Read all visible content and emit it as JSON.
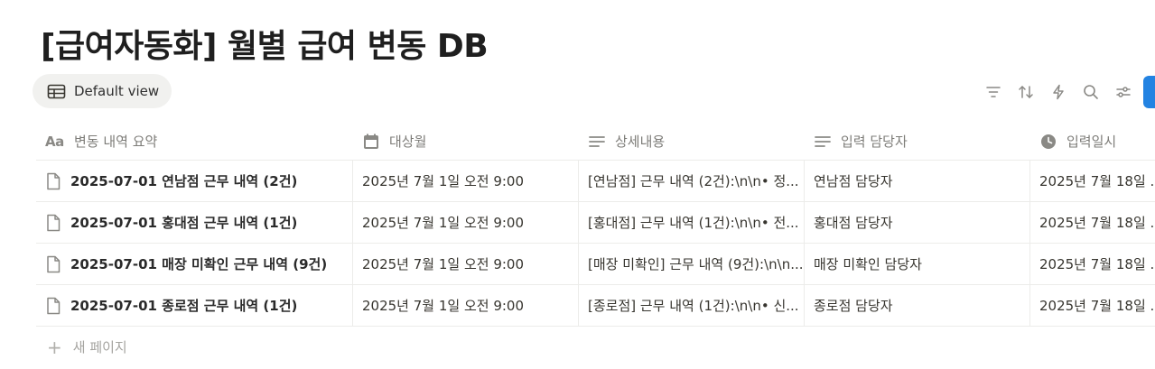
{
  "page": {
    "title": "[급여자동화] 월별 급여 변동 DB"
  },
  "views": {
    "active_label": "Default view"
  },
  "toolbar": {
    "icons": [
      "filter-icon",
      "sort-icon",
      "automation-icon",
      "search-icon",
      "settings-icon"
    ]
  },
  "table": {
    "columns": [
      {
        "label": "변동 내역 요약",
        "icon": "title-aa-icon"
      },
      {
        "label": "대상월",
        "icon": "calendar-icon"
      },
      {
        "label": "상세내용",
        "icon": "text-lines-icon"
      },
      {
        "label": "입력 담당자",
        "icon": "text-lines-icon"
      },
      {
        "label": "입력일시",
        "icon": "clock-icon"
      }
    ],
    "rows": [
      {
        "summary": "2025-07-01 연남점 근무 내역 (2건)",
        "target_month": "2025년 7월 1일 오전 9:00",
        "detail": "[연남점] 근무 내역 (2건):\\n\\n• 정...",
        "manager": "연남점 담당자",
        "entered_at": "2025년 7월 18일 ..."
      },
      {
        "summary": "2025-07-01 홍대점 근무 내역 (1건)",
        "target_month": "2025년 7월 1일 오전 9:00",
        "detail": "[홍대점] 근무 내역 (1건):\\n\\n• 전...",
        "manager": "홍대점 담당자",
        "entered_at": "2025년 7월 18일 ..."
      },
      {
        "summary": "2025-07-01 매장 미확인 근무 내역 (9건)",
        "target_month": "2025년 7월 1일 오전 9:00",
        "detail": "[매장 미확인] 근무 내역 (9건):\\n\\n...",
        "manager": "매장 미확인 담당자",
        "entered_at": "2025년 7월 18일 ..."
      },
      {
        "summary": "2025-07-01 종로점 근무 내역 (1건)",
        "target_month": "2025년 7월 1일 오전 9:00",
        "detail": "[종로점] 근무 내역 (1건):\\n\\n• 신...",
        "manager": "종로점 담당자",
        "entered_at": "2025년 7월 18일 ..."
      }
    ],
    "new_page_label": "새 페이지"
  },
  "colors": {
    "accent": "#2383e2",
    "text": "#37352f",
    "muted": "#7d7c78",
    "divider": "#ececea",
    "tab_bg": "#f1f1ef"
  }
}
